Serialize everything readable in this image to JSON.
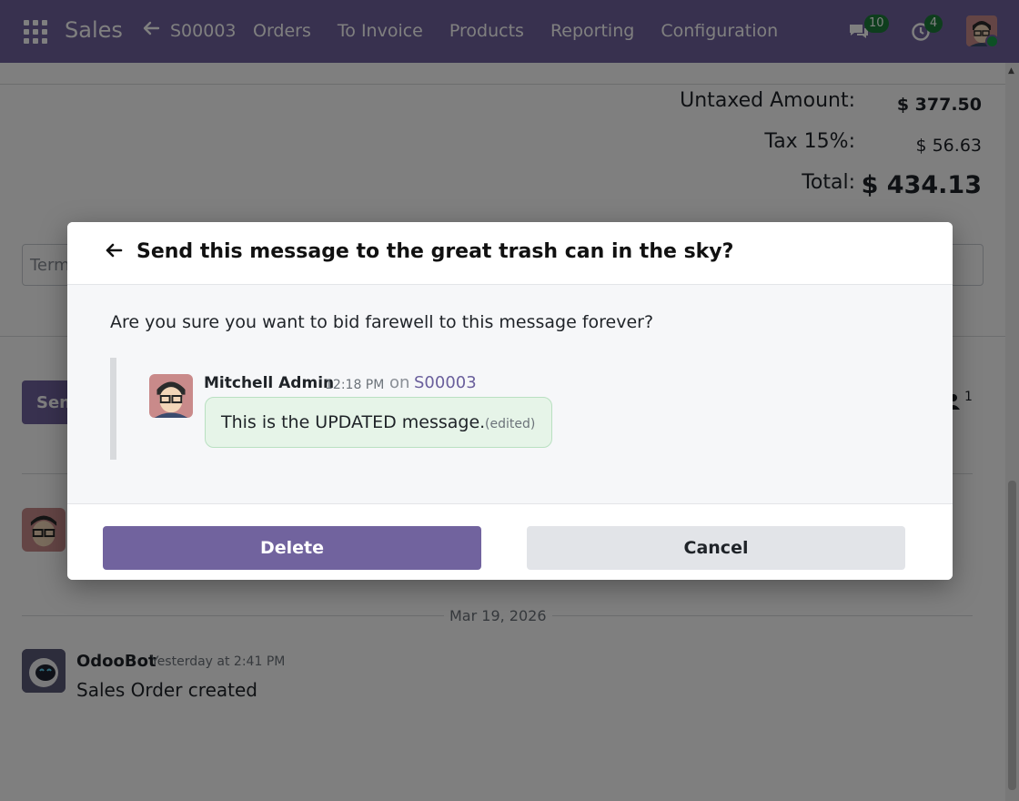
{
  "navbar": {
    "app_name": "Sales",
    "breadcrumb": "S00003",
    "menu": [
      "Orders",
      "To Invoice",
      "Products",
      "Reporting",
      "Configuration"
    ],
    "chat_badge": "10",
    "activity_badge": "4",
    "accent": "#71639e"
  },
  "totals": {
    "untaxed_label": "Untaxed Amount:",
    "untaxed_value": "$ 377.50",
    "tax_label": "Tax 15%:",
    "tax_value": "$ 56.63",
    "total_label": "Total:",
    "total_value": "$ 434.13"
  },
  "terms": {
    "placeholder": "Term"
  },
  "chatter": {
    "send_label": "Sen",
    "follower_count": "1",
    "date_separator": "Mar 19, 2026",
    "bot_message": {
      "author": "OdooBot",
      "time": "Yesterday at 2:41 PM",
      "body": "Sales Order created"
    }
  },
  "dialog": {
    "title": "Send this message to the great trash can in the sky?",
    "question": "Are you sure you want to bid farewell to this message forever?",
    "message": {
      "author": "Mitchell Admin",
      "time": "12:18 PM",
      "on": "on",
      "record": "S00003",
      "text": "This is the UPDATED message.",
      "edited": "(edited)"
    },
    "delete_label": "Delete",
    "cancel_label": "Cancel"
  }
}
